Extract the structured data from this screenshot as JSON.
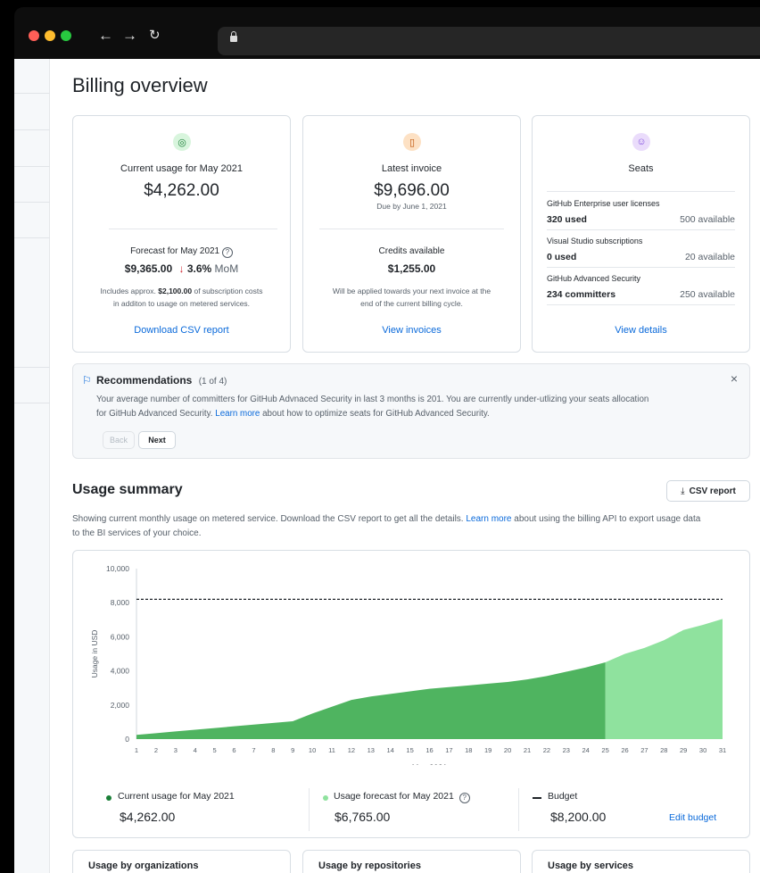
{
  "page": {
    "title": "Billing overview"
  },
  "cards": {
    "usage": {
      "label": "Current usage for May 2021",
      "amount": "$4,262.00",
      "forecast_label": "Forecast for May 2021",
      "forecast_amount": "$9,365.00",
      "forecast_change": "3.6%",
      "forecast_unit": "MoM",
      "note_pre": "Includes approx.",
      "note_amount": "$2,100.00",
      "note_post": "of subscription costs",
      "note_line2": "in additon to usage on metered services.",
      "link": "Download CSV report"
    },
    "invoice": {
      "label": "Latest invoice",
      "amount": "$9,696.00",
      "due": "Due by June 1, 2021",
      "credits_label": "Credits available",
      "credits_amount": "$1,255.00",
      "note_line1": "Will be applied towards your next invoice at the",
      "note_line2": "end of the current billing cycle.",
      "link": "View invoices"
    },
    "seats": {
      "label": "Seats",
      "rows": [
        {
          "name": "GitHub Enterprise user licenses",
          "used": "320 used",
          "available": "500 available"
        },
        {
          "name": "Visual Studio subscriptions",
          "used": "0 used",
          "available": "20 available"
        },
        {
          "name": "GitHub Advanced Security",
          "used": "234 committers",
          "available": "250 available"
        }
      ],
      "link": "View details"
    }
  },
  "recommendations": {
    "title": "Recommendations",
    "count": "(1 of 4)",
    "line1": "Your average number of committers for GitHub Advnaced Security in last 3 months is 201. You are currently under-utlizing your seats allocation",
    "line2_pre": "for GitHub Advanced Security.",
    "line2_link": "Learn more",
    "line2_post": "about how to optimize seats for GitHub Advanced Security.",
    "back_label": "Back",
    "next_label": "Next",
    "close_label": "×"
  },
  "usage_summary": {
    "title": "Usage summary",
    "csv_button": "CSV report",
    "desc_pre": "Showing current monthly usage on metered service. Download the CSV report to get all the details.",
    "desc_link": "Learn more",
    "desc_post": "about using the billing API to export usage data",
    "desc_line2": "to the BI services of your choice."
  },
  "legend": {
    "current_label": "Current  usage for May 2021",
    "current_value": "$4,262.00",
    "forecast_label": "Usage forecast for May 2021",
    "forecast_value": "$6,765.00",
    "budget_label": "Budget",
    "budget_value": "$8,200.00",
    "edit_budget": "Edit budget"
  },
  "bottom_cards": [
    "Usage by organizations",
    "Usage by repositories",
    "Usage by services"
  ],
  "colors": {
    "current": "#4fb460",
    "forecast": "#8fe29e",
    "link": "#0969da",
    "usage_icon_bg": "#d8f5dd",
    "invoice_icon_bg": "#fde1c4",
    "seats_icon_bg": "#eadcfb"
  },
  "chart_data": {
    "type": "area",
    "xlabel": "May 2021",
    "ylabel": "Usage in USD",
    "ylim": [
      0,
      10000
    ],
    "yticks": [
      0,
      2000,
      4000,
      6000,
      8000,
      10000
    ],
    "ytick_labels": [
      "0",
      "2,000",
      "4,000",
      "6,000",
      "8,000",
      "10,000"
    ],
    "x": [
      1,
      2,
      3,
      4,
      5,
      6,
      7,
      8,
      9,
      10,
      11,
      12,
      13,
      14,
      15,
      16,
      17,
      18,
      19,
      20,
      21,
      22,
      23,
      24,
      25,
      26,
      27,
      28,
      29,
      30,
      31
    ],
    "series": [
      {
        "values": [
          250,
          350,
          450,
          550,
          650,
          750,
          850,
          950,
          1050,
          1500,
          1900,
          2300,
          2500,
          2650,
          2800,
          2950,
          3050,
          3150,
          3250,
          3350,
          3500,
          3700,
          3950,
          4200,
          4500,
          null,
          null,
          null,
          null,
          null,
          null
        ]
      },
      {
        "values": [
          null,
          null,
          null,
          null,
          null,
          null,
          null,
          null,
          null,
          null,
          null,
          null,
          null,
          null,
          null,
          null,
          null,
          null,
          null,
          null,
          null,
          null,
          null,
          null,
          4500,
          5000,
          5350,
          5800,
          6400,
          6700,
          7050
        ]
      }
    ],
    "budget": 8200,
    "grid": false
  }
}
